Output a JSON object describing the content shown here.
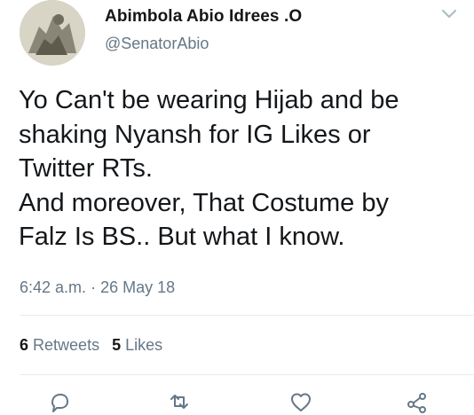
{
  "tweet": {
    "author_name": "Abimbola Abio Idrees .O",
    "author_handle": "@SenatorAbio",
    "text": "Yo Can't be wearing Hijab and be\nshaking Nyansh for IG Likes or\nTwitter RTs.\nAnd moreover, That Costume by\nFalz Is BS.. But what I know.",
    "time": "6:42 a.m.",
    "separator": "·",
    "date": "26 May 18",
    "retweets_count": "6",
    "retweets_label": "Retweets",
    "likes_count": "5",
    "likes_label": "Likes"
  },
  "icons": {
    "menu": "chevron-down-icon",
    "reply": "reply-icon",
    "retweet": "retweet-icon",
    "like": "heart-icon",
    "share": "share-icon"
  },
  "colors": {
    "text": "#14171a",
    "secondary": "#657786",
    "divider": "#e6ecf0"
  }
}
